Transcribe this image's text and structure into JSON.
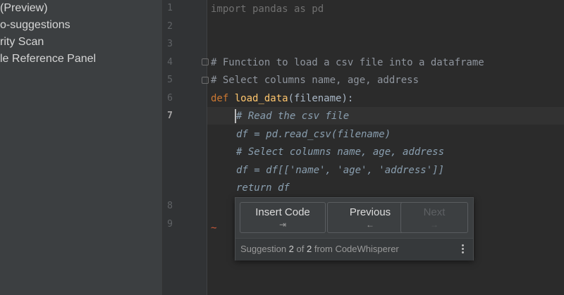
{
  "sidebar": {
    "items": [
      {
        "label": "(Preview)"
      },
      {
        "label": "o-suggestions"
      },
      {
        "label": "rity Scan"
      },
      {
        "label": "le Reference Panel"
      }
    ]
  },
  "gutter": {
    "line_numbers": [
      "1",
      "2",
      "3",
      "4",
      "5",
      "6",
      "7",
      "8",
      "9"
    ],
    "current_line": "7"
  },
  "editor": {
    "code": {
      "line1": "import pandas as pd",
      "line4": "# Function to load a csv file into a dataframe",
      "line5": "# Select columns name, age, address",
      "line6_kw": "def",
      "line6_fn": "load_data",
      "line6_open": "(",
      "line6_param": "filename",
      "line6_close": "):",
      "ghost1": "# Read the csv file",
      "ghost2": "df = pd.read_csv(filename)",
      "ghost3": "# Select columns name, age, address",
      "ghost4": "df = df[['name', 'age', 'address']]",
      "ghost5": "return df",
      "line9": "~"
    }
  },
  "suggestion_popup": {
    "insert_label": "Insert Code",
    "insert_key": "⇥",
    "previous_label": "Previous",
    "previous_key": "←",
    "next_label": "Next",
    "next_key": "→",
    "footer_prefix": "Suggestion ",
    "footer_current": "2",
    "footer_of": " of ",
    "footer_total": "2",
    "footer_suffix": " from CodeWhisperer",
    "more_icon": "more-vertical-icon"
  },
  "colors": {
    "keyword": "#cc7832",
    "function": "#ffc66d",
    "ghost_text": "#8a9fb0"
  }
}
